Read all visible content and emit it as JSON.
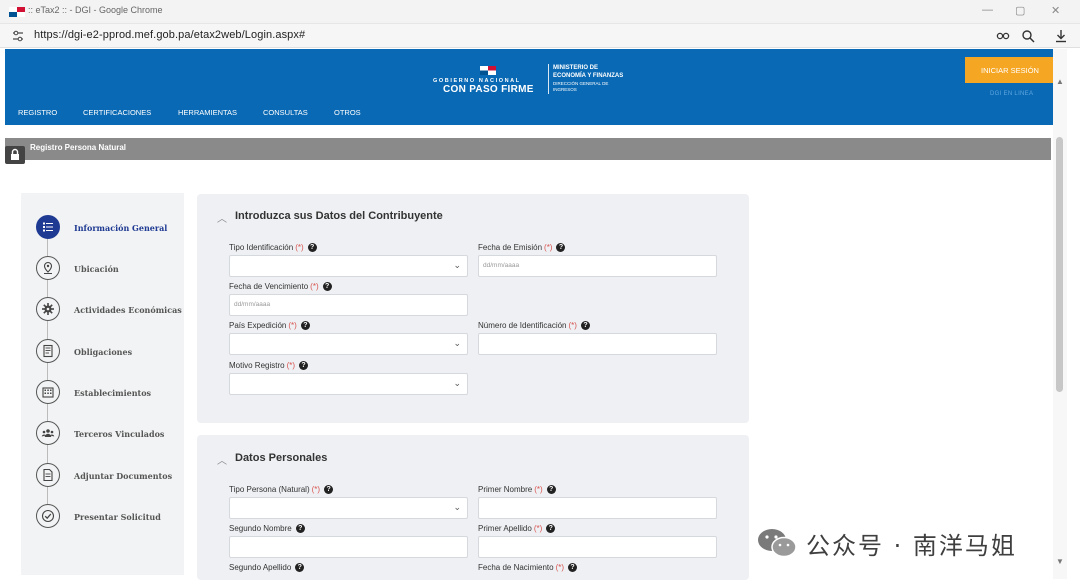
{
  "browser": {
    "window_title": ":: eTax2 :: - DGI - Google Chrome",
    "url": "https://dgi-e2-pprod.mef.gob.pa/etax2web/Login.aspx#",
    "controls": {
      "minimize": "—",
      "restore": "▢",
      "close": "✕"
    }
  },
  "header": {
    "gob_line1": "GOBIERNO NACIONAL",
    "gob_line2": "CON PASO FIRME",
    "ministry_line1": "MINISTERIO DE",
    "ministry_line2": "ECONOMÍA Y FINANZAS",
    "ministry_line3": "DIRECCIÓN GENERAL DE",
    "ministry_line4": "INGRESOS",
    "login_button": "INICIAR SESIÓN",
    "online_label": "DGI EN LINEA",
    "nav": [
      "REGISTRO",
      "CERTIFICACIONES",
      "HERRAMIENTAS",
      "CONSULTAS",
      "OTROS"
    ]
  },
  "page": {
    "section_title": "Registro Persona Natural"
  },
  "steps": [
    {
      "label": "Información General",
      "icon": "list-icon",
      "active": true
    },
    {
      "label": "Ubicación",
      "icon": "location-pin-icon"
    },
    {
      "label": "Actividades Económicas",
      "icon": "gear-icon"
    },
    {
      "label": "Obligaciones",
      "icon": "document-icon"
    },
    {
      "label": "Establecimientos",
      "icon": "building-icon"
    },
    {
      "label": "Terceros Vinculados",
      "icon": "people-icon"
    },
    {
      "label": "Adjuntar Documentos",
      "icon": "attachment-document-icon"
    },
    {
      "label": "Presentar Solicitud",
      "icon": "check-circle-icon"
    }
  ],
  "panel1": {
    "title": "Introduzca sus Datos del Contribuyente",
    "tipo_identificacion": "Tipo Identificación",
    "fecha_emision": "Fecha de Emisión",
    "fecha_emision_placeholder": "dd/mm/aaaa",
    "fecha_vencimiento": "Fecha de Vencimiento",
    "fecha_vencimiento_placeholder": "dd/mm/aaaa",
    "pais_expedicion": "País Expedición",
    "numero_identificacion": "Número de Identificación",
    "motivo_registro": "Motivo Registro"
  },
  "panel2": {
    "title": "Datos Personales",
    "tipo_persona": "Tipo Persona (Natural)",
    "primer_nombre": "Primer Nombre",
    "segundo_nombre": "Segundo Nombre",
    "primer_apellido": "Primer Apellido",
    "segundo_apellido": "Segundo Apellido",
    "fecha_nacimiento": "Fecha de Nacimiento"
  },
  "required_mark": "(*)",
  "help_mark": "?",
  "watermark": "公众号 · 南洋马姐",
  "colors": {
    "header_blue": "#0a69b4",
    "login_orange": "#f5a623",
    "active_step": "#1f3a93",
    "required_red": "#d9534f"
  }
}
